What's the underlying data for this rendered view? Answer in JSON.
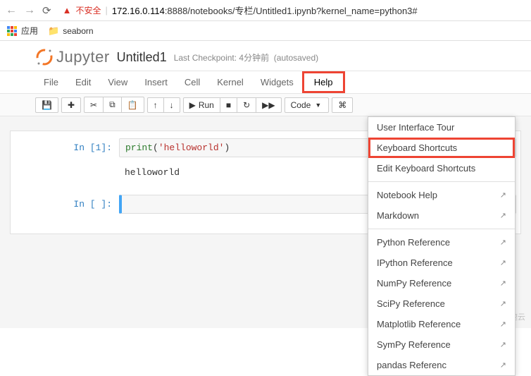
{
  "browser": {
    "insecure_label": "不安全",
    "url_host": "172.16.0.114",
    "url_rest": ":8888/notebooks/专栏/Untitled1.ipynb?kernel_name=python3#",
    "apps_label": "应用",
    "bookmark_seaborn": "seaborn"
  },
  "header": {
    "logo_text": "Jupyter",
    "title": "Untitled1",
    "checkpoint": "Last Checkpoint: 4分钟前",
    "autosave": "(autosaved)"
  },
  "menu": {
    "file": "File",
    "edit": "Edit",
    "view": "View",
    "insert": "Insert",
    "cell": "Cell",
    "kernel": "Kernel",
    "widgets": "Widgets",
    "help": "Help"
  },
  "toolbar": {
    "run_label": "Run",
    "celltype": "Code"
  },
  "cells": {
    "in1_prompt": "In [1]:",
    "in1_code_fn": "print",
    "in1_code_paren_open": "(",
    "in1_code_str": "'helloworld'",
    "in1_code_paren_close": ")",
    "out1": "helloworld",
    "in_blank_prompt": "In [ ]:"
  },
  "help_menu": {
    "ui_tour": "User Interface Tour",
    "kb_shortcuts": "Keyboard Shortcuts",
    "edit_kb_shortcuts": "Edit Keyboard Shortcuts",
    "notebook_help": "Notebook Help",
    "markdown": "Markdown",
    "python_ref": "Python Reference",
    "ipython_ref": "IPython Reference",
    "numpy_ref": "NumPy Reference",
    "scipy_ref": "SciPy Reference",
    "matplotlib_ref": "Matplotlib Reference",
    "sympy_ref": "SymPy Reference",
    "pandas_ref": "pandas Referenc"
  },
  "watermark": "亿速云"
}
